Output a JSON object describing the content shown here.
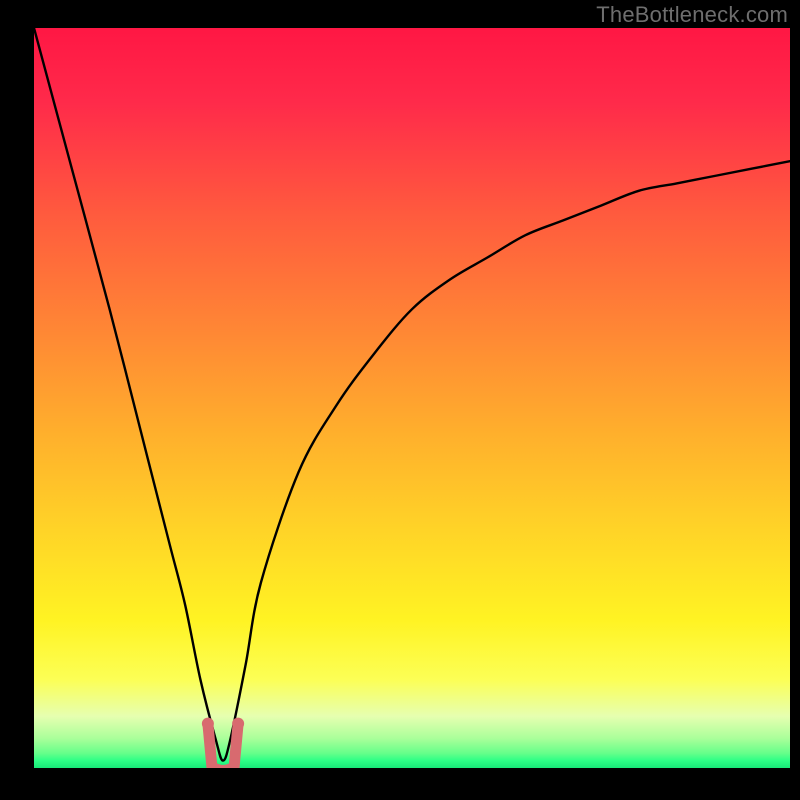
{
  "watermark": "TheBottleneck.com",
  "colors": {
    "frame": "#000000",
    "curve": "#000000",
    "dip_marker": "#d86a6f",
    "gradient_top": "#ff1744",
    "gradient_bottom": "#18e878"
  },
  "chart_data": {
    "type": "line",
    "title": "",
    "xlabel": "",
    "ylabel": "",
    "xlim": [
      0,
      100
    ],
    "ylim": [
      0,
      100
    ],
    "x": [
      0,
      5,
      10,
      15,
      18,
      20,
      22,
      24,
      25,
      26,
      28,
      30,
      35,
      40,
      45,
      50,
      55,
      60,
      65,
      70,
      75,
      80,
      85,
      90,
      95,
      100
    ],
    "values": [
      100,
      81,
      62,
      42,
      30,
      22,
      12,
      4,
      1,
      4,
      14,
      25,
      40,
      49,
      56,
      62,
      66,
      69,
      72,
      74,
      76,
      78,
      79,
      80,
      81,
      82
    ],
    "marker": {
      "x_range": [
        23,
        27
      ],
      "y": 1,
      "shape": "u",
      "color": "#d86a6f"
    },
    "notes": "V-shaped curve with minimum near x≈25, y≈1; rises steeply toward both ends. Background is a vertical gradient red→orange→yellow→green."
  }
}
